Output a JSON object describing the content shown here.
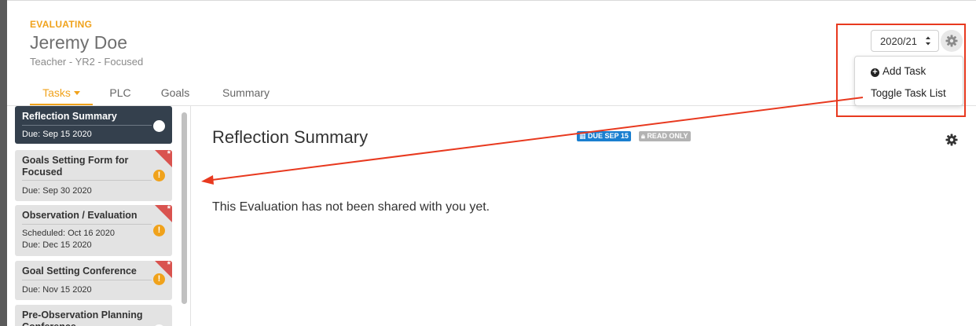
{
  "header": {
    "status_label": "EVALUATING",
    "person_name": "Jeremy Doe",
    "person_role": "Teacher - YR2 - Focused"
  },
  "tabs": [
    {
      "label": "Tasks",
      "active": true
    },
    {
      "label": "PLC",
      "active": false
    },
    {
      "label": "Goals",
      "active": false
    },
    {
      "label": "Summary",
      "active": false
    }
  ],
  "year_select": {
    "value": "2020/21"
  },
  "settings_menu": {
    "items": [
      {
        "label": "Add Task",
        "icon": "plus-circle-icon"
      },
      {
        "label": "Toggle Task List"
      }
    ]
  },
  "tasks": [
    {
      "title": "Reflection Summary",
      "meta": [
        "Due: Sep 15 2020"
      ],
      "active": true,
      "status_icon": "circle-icon"
    },
    {
      "title": "Goals Setting Form for Focused",
      "meta": [
        "Due: Sep 30 2020"
      ],
      "active": false,
      "status_icon": "alert-icon",
      "flag": "*"
    },
    {
      "title": "Observation / Evaluation",
      "meta": [
        "Scheduled: Oct 16 2020",
        "Due: Dec 15 2020"
      ],
      "active": false,
      "status_icon": "alert-icon",
      "flag": "*"
    },
    {
      "title": "Goal Setting Conference",
      "meta": [
        "Due: Nov 15 2020"
      ],
      "active": false,
      "status_icon": "alert-icon",
      "flag": "*"
    },
    {
      "title": "Pre-Observation Planning Conference",
      "meta": [],
      "active": false,
      "status_icon": "circle-icon"
    }
  ],
  "content": {
    "title": "Reflection Summary",
    "due_badge": "DUE SEP 15",
    "readonly_badge": "READ ONLY",
    "message": "This Evaluation has not been shared with you yet."
  },
  "colors": {
    "accent": "#f0a21b",
    "active_task_bg": "#34404d",
    "due_badge": "#1a7fd0",
    "flag": "#d9534f",
    "annotation": "#e8391f"
  }
}
